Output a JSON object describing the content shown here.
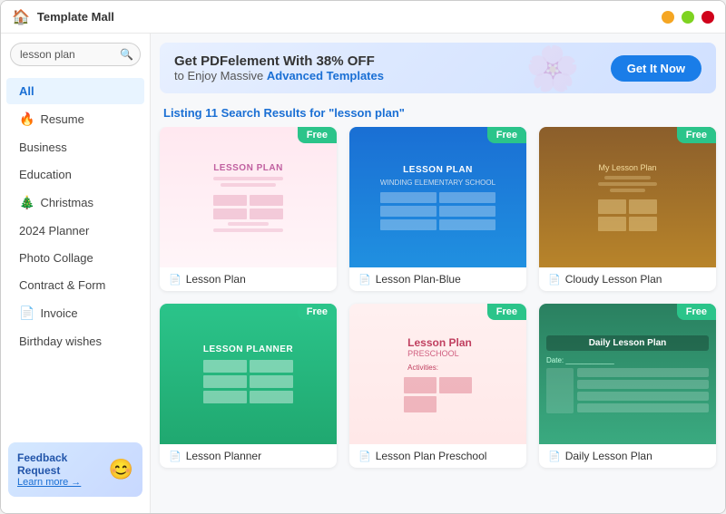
{
  "window": {
    "title": "Template Mall"
  },
  "sidebar": {
    "search_placeholder": "lesson plan",
    "nav_items": [
      {
        "id": "all",
        "label": "All",
        "icon": "",
        "active": true
      },
      {
        "id": "resume",
        "label": "Resume",
        "icon": "🔥",
        "active": false
      },
      {
        "id": "business",
        "label": "Business",
        "icon": "",
        "active": false
      },
      {
        "id": "education",
        "label": "Education",
        "icon": "",
        "active": false
      },
      {
        "id": "christmas",
        "label": "Christmas",
        "icon": "🎄",
        "active": false
      },
      {
        "id": "planner",
        "label": "2024 Planner",
        "icon": "",
        "active": false
      },
      {
        "id": "photo-collage",
        "label": "Photo Collage",
        "icon": "",
        "active": false
      },
      {
        "id": "contract",
        "label": "Contract & Form",
        "icon": "",
        "active": false
      },
      {
        "id": "invoice",
        "label": "Invoice",
        "icon": "📄",
        "active": false
      },
      {
        "id": "birthday",
        "label": "Birthday wishes",
        "icon": "",
        "active": false
      }
    ],
    "feedback": {
      "title": "Feedback Request",
      "link": "Learn more →",
      "emoji": "😊"
    }
  },
  "banner": {
    "main_text": "Get PDFelement With 38% OFF",
    "sub_text": "to Enjoy Massive",
    "highlight_text": "Advanced Templates",
    "button_label": "Get It Now"
  },
  "results": {
    "header": "Listing 11 Search Results for",
    "query": "\"lesson plan\""
  },
  "templates": [
    {
      "id": 1,
      "label": "Lesson Plan",
      "badge": "Free",
      "preview": "1"
    },
    {
      "id": 2,
      "label": "Lesson Plan-Blue",
      "badge": "Free",
      "preview": "2"
    },
    {
      "id": 3,
      "label": "Cloudy Lesson Plan",
      "badge": "Free",
      "preview": "3"
    },
    {
      "id": 4,
      "label": "Lesson Planner",
      "badge": "Free",
      "preview": "4"
    },
    {
      "id": 5,
      "label": "Lesson Plan Preschool",
      "badge": "Free",
      "preview": "5"
    },
    {
      "id": 6,
      "label": "Daily Lesson Plan",
      "badge": "Free",
      "preview": "6"
    }
  ]
}
